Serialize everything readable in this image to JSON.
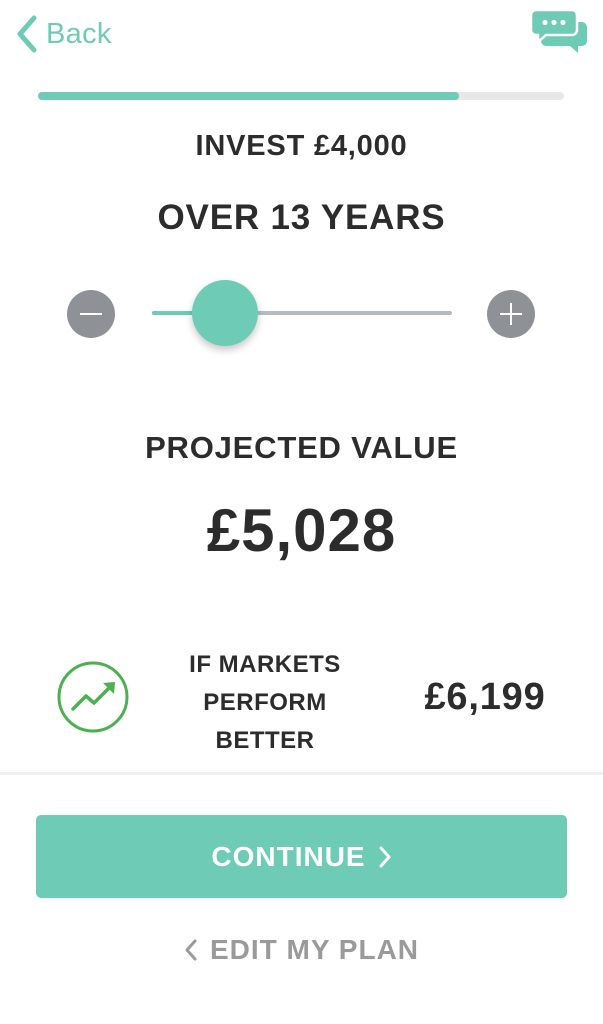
{
  "header": {
    "back_label": "Back",
    "chat_icon": "chat-bubbles-icon"
  },
  "progress": {
    "fraction": 0.8
  },
  "plan": {
    "invest_text": "INVEST £4,000",
    "years_text": "OVER 13 YEARS",
    "slider_fraction": 0.25
  },
  "projection": {
    "label": "PROJECTED VALUE",
    "value": "£5,028"
  },
  "better": {
    "label_lines": [
      "IF MARKETS",
      "PERFORM",
      "BETTER"
    ],
    "value": "£6,199",
    "icon": "trend-up-icon"
  },
  "actions": {
    "continue_label": "CONTINUE",
    "edit_label": "EDIT MY PLAN"
  },
  "colors": {
    "accent": "#6ecbb5",
    "trend_green": "#4caf50",
    "stepper_grey": "#8e9297"
  }
}
